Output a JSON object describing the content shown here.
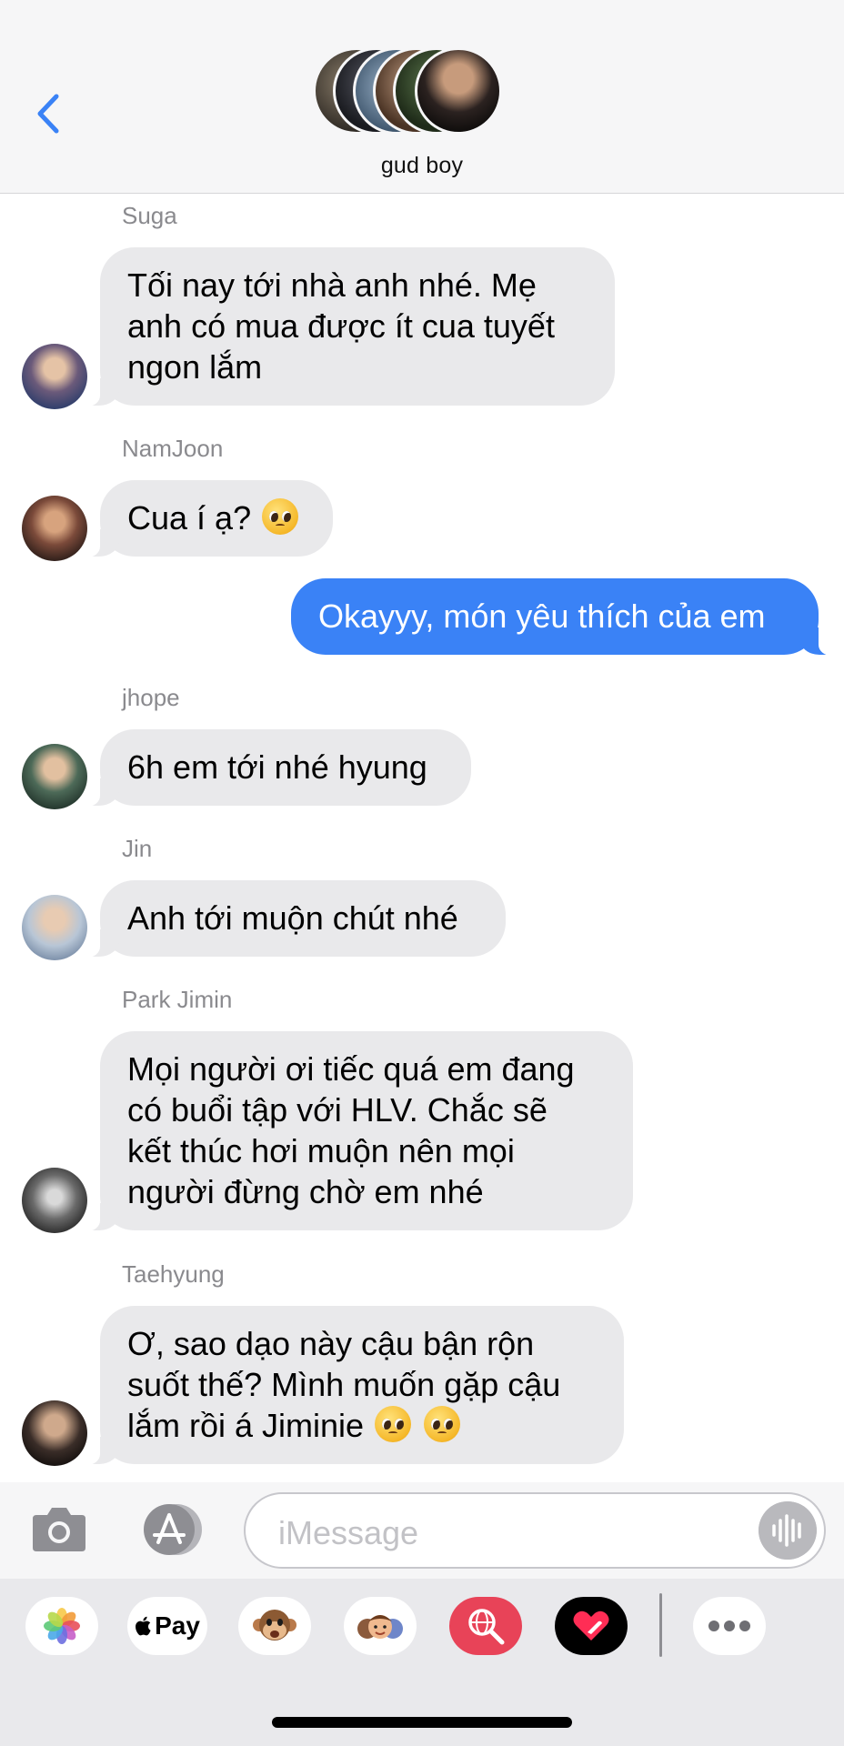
{
  "header": {
    "group_name": "gud boy",
    "back_icon": "chevron-left-icon"
  },
  "colors": {
    "accent": "#3a82f6",
    "incoming_bubble": "#e9e9eb",
    "sender_label": "#8a8a8e"
  },
  "messages": [
    {
      "sender": "Suga",
      "direction": "incoming",
      "lines": [
        "Tối nay tới nhà anh nhé. Mẹ",
        "anh có mua được ít cua tuyết",
        "ngon lắm"
      ]
    },
    {
      "sender": "NamJoon",
      "direction": "incoming",
      "text": "Cua í ạ?",
      "emoji": "pleading-face"
    },
    {
      "sender": "",
      "direction": "outgoing",
      "text": "Okayyy, món yêu thích của em"
    },
    {
      "sender": "jhope",
      "direction": "incoming",
      "text": "6h em tới nhé hyung"
    },
    {
      "sender": "Jin",
      "direction": "incoming",
      "text": "Anh tới muộn chút nhé"
    },
    {
      "sender": "Park Jimin",
      "direction": "incoming",
      "lines": [
        "Mọi người ơi tiếc quá em đang",
        "có buổi tập với HLV. Chắc sẽ",
        "kết thúc hơi muộn nên mọi",
        "người đừng chờ em nhé"
      ]
    },
    {
      "sender": "Taehyung",
      "direction": "incoming",
      "lines": [
        "Ơ, sao dạo này cậu bận rộn",
        "suốt thế? Mình muốn gặp cậu",
        "lắm rồi á Jiminie"
      ],
      "emoji": "pleading-face x2"
    }
  ],
  "composer": {
    "placeholder": "iMessage",
    "camera_icon": "camera-icon",
    "apps_icon": "app-store-icon",
    "audio_icon": "waveform-icon"
  },
  "app_drawer": {
    "items": [
      "photos-icon",
      "apple-pay",
      "animoji-monkey-icon",
      "memoji-icon",
      "web-search-icon",
      "digital-touch-icon",
      "more-icon"
    ],
    "pay_label": "Pay"
  }
}
